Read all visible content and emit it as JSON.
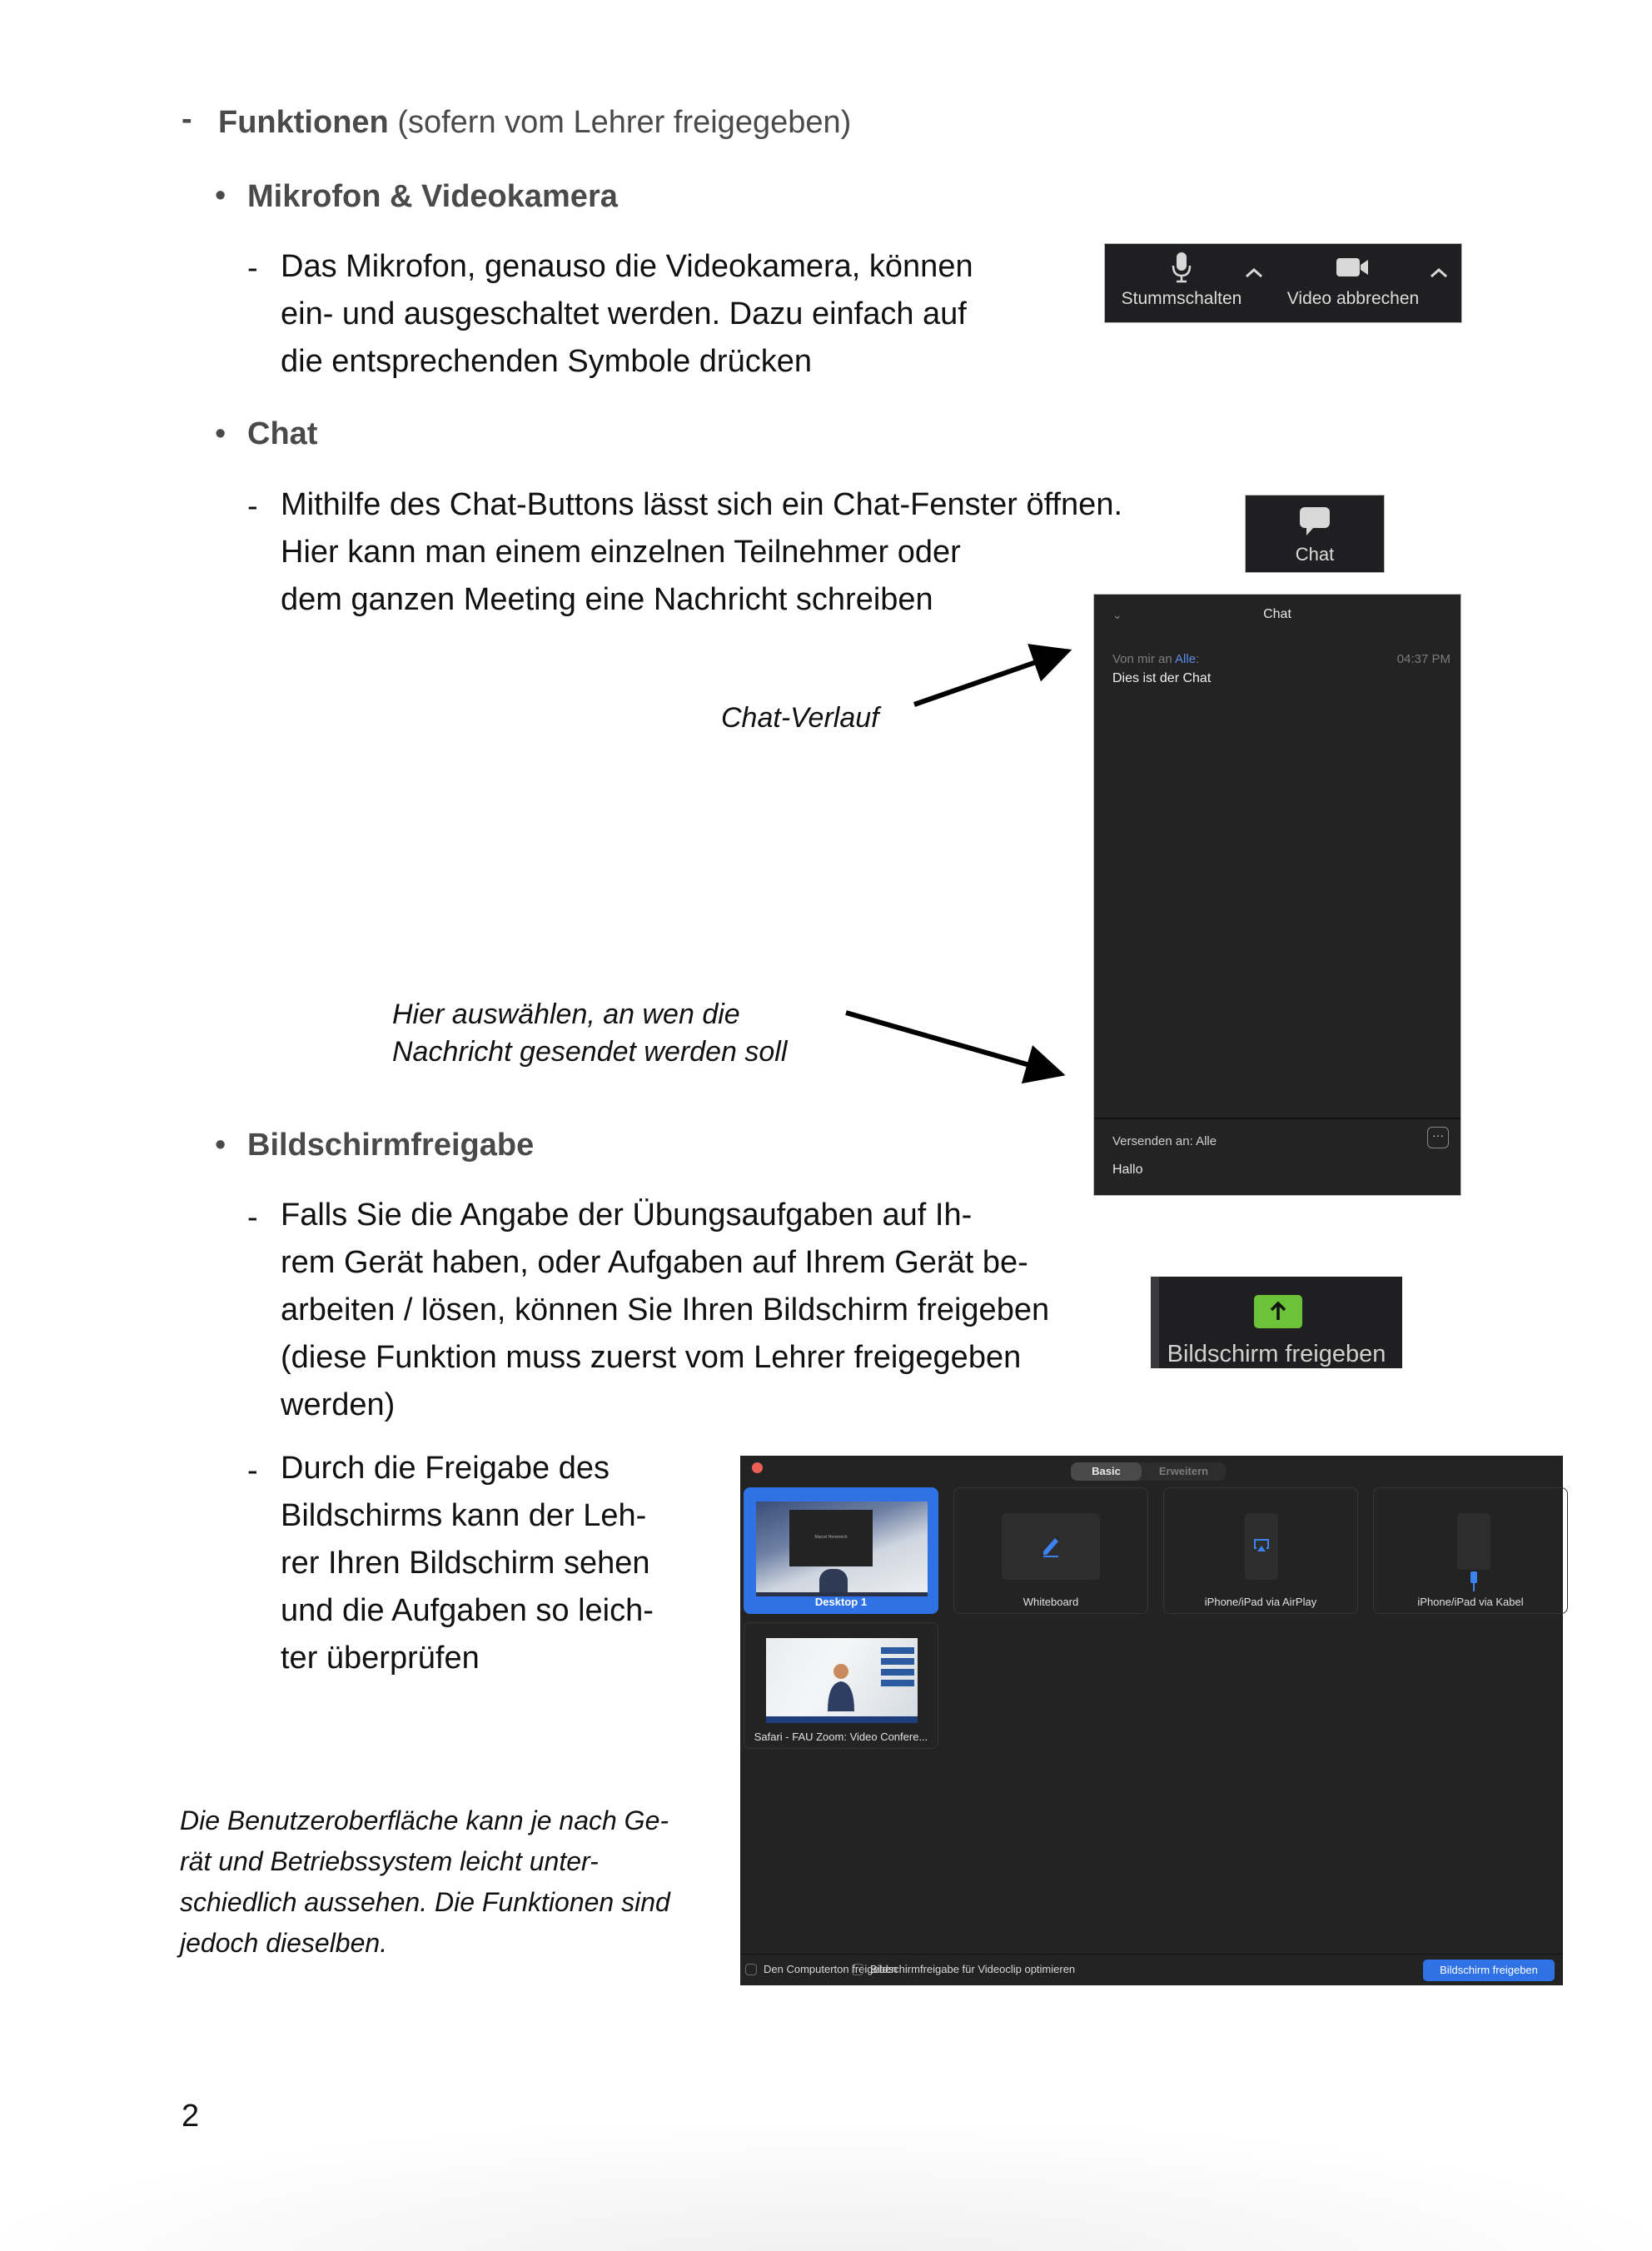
{
  "document": {
    "section": {
      "dash": "-",
      "title_bold": "Funktionen",
      "title_rest": " (sofern vom Lehrer freigegeben)"
    },
    "bullet_char": "•",
    "item_dash": "-",
    "topics": [
      {
        "heading": "Mikrofon & Videokamera",
        "paragraphs": [
          {
            "lines": [
              "Das Mikrofon, genauso die Videokamera, können",
              "ein- und ausgeschaltet werden. Dazu einfach auf",
              "die entsprechenden Symbole drücken"
            ]
          }
        ]
      },
      {
        "heading": "Chat",
        "paragraphs": [
          {
            "lines": [
              "Mithilfe des Chat-Buttons lässt sich ein Chat-Fenster öffnen.",
              "Hier kann man einem einzelnen Teilnehmer oder",
              "dem ganzen Meeting eine Nachricht schreiben"
            ]
          }
        ]
      },
      {
        "heading": "Bildschirmfreigabe",
        "paragraphs": [
          {
            "lines": [
              "Falls Sie die Angabe der Übungsaufgaben auf Ih-",
              "rem Gerät haben, oder Aufgaben auf Ihrem Gerät be-",
              "arbeiten / lösen, können Sie Ihren Bildschirm freigeben",
              "(diese Funktion muss zuerst vom Lehrer freigegeben",
              "werden)"
            ]
          },
          {
            "lines": [
              "Durch die Freigabe des",
              "Bildschirms kann der Leh-",
              "rer Ihren Bildschirm sehen",
              "und die Aufgaben so leich-",
              "ter überprüfen"
            ]
          }
        ]
      }
    ],
    "callouts": {
      "chat_history": "Chat-Verlauf",
      "recipient": [
        "Hier auswählen, an wen die",
        "Nachricht gesendet werden soll"
      ]
    },
    "note_lines": [
      "Die Benutzeroberfläche kann je nach Ge-",
      "rät und Betriebssystem leicht unter-",
      "schiedlich aussehen. Die Funktionen sind",
      "jedoch dieselben."
    ],
    "page_number": "2"
  },
  "zoom_toolbar": {
    "mute": {
      "label": "Stummschalten",
      "icon": "microphone-icon"
    },
    "video": {
      "label": "Video abbrechen",
      "icon": "video-camera-icon"
    }
  },
  "chat_button": {
    "label": "Chat",
    "icon": "speech-bubble-icon"
  },
  "chat_window": {
    "title": "Chat",
    "collapse_glyph": "⌄",
    "message": {
      "from_prefix": "Von mir an ",
      "to": "Alle",
      "suffix": ":",
      "time": "04:37 PM",
      "text": "Dies ist der Chat"
    },
    "send_to_label": "Versenden an: Alle",
    "more_glyph": "···",
    "input_value": "Hallo"
  },
  "share_button": {
    "label": "Bildschirm freigeben",
    "icon": "share-screen-arrow-icon"
  },
  "share_dialog": {
    "tabs": [
      {
        "label": "Basic",
        "active": true
      },
      {
        "label": "Erweitern",
        "active": false
      }
    ],
    "tiles": [
      {
        "label": "Desktop 1",
        "selected": true
      },
      {
        "label": "Whiteboard",
        "selected": false
      },
      {
        "label": "iPhone/iPad via AirPlay",
        "selected": false
      },
      {
        "label": "iPhone/iPad via Kabel",
        "selected": false
      },
      {
        "label": "Safari - FAU Zoom: Video Confere...",
        "selected": false
      }
    ],
    "desktop_window_caption": "Marcel Hemmrich",
    "options": [
      {
        "label": "Den Computerton freigeben",
        "checked": false
      },
      {
        "label": "Bildschirmfreigabe für Videoclip optimieren",
        "checked": false
      }
    ],
    "primary_button": "Bildschirm freigeben",
    "colors": {
      "accent": "#2f72e6",
      "close": "#ec5f57",
      "share_green": "#6cc33a"
    }
  }
}
